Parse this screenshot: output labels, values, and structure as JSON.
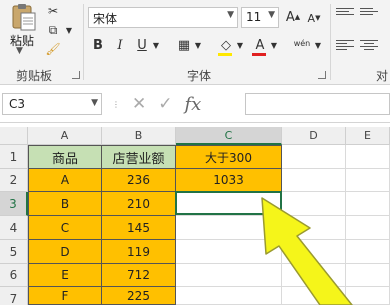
{
  "ribbon": {
    "clipboard": {
      "paste_label": "粘贴",
      "group_label": "剪贴板"
    },
    "font": {
      "family": "宋体",
      "size": "11",
      "grow": "A",
      "shrink": "A",
      "bold": "B",
      "italic": "I",
      "underline": "U",
      "font_color_glyph": "A",
      "phonetic": "wén",
      "group_label": "字体"
    },
    "alignment": {
      "group_label_partial": "对"
    }
  },
  "formula_bar": {
    "name_box": "C3",
    "cancel": "✕",
    "enter": "✓",
    "fx": "fx",
    "content": ""
  },
  "sheet": {
    "columns": [
      "A",
      "B",
      "C",
      "D",
      "E"
    ],
    "rows": [
      "1",
      "2",
      "3",
      "4",
      "5",
      "6",
      "7"
    ],
    "headers": {
      "a1": "商品",
      "b1": "店营业额",
      "c1": "大于300"
    },
    "products": [
      "A",
      "B",
      "C",
      "D",
      "E",
      "F"
    ],
    "revenue": [
      "236",
      "210",
      "145",
      "119",
      "712",
      "225"
    ],
    "c2": "1033",
    "selected_cell": "C3"
  },
  "colors": {
    "accent": "#217346",
    "cell_orange": "#ffc000",
    "cell_green": "#c6e0b4",
    "arrow_yellow": "#f5f51a"
  }
}
